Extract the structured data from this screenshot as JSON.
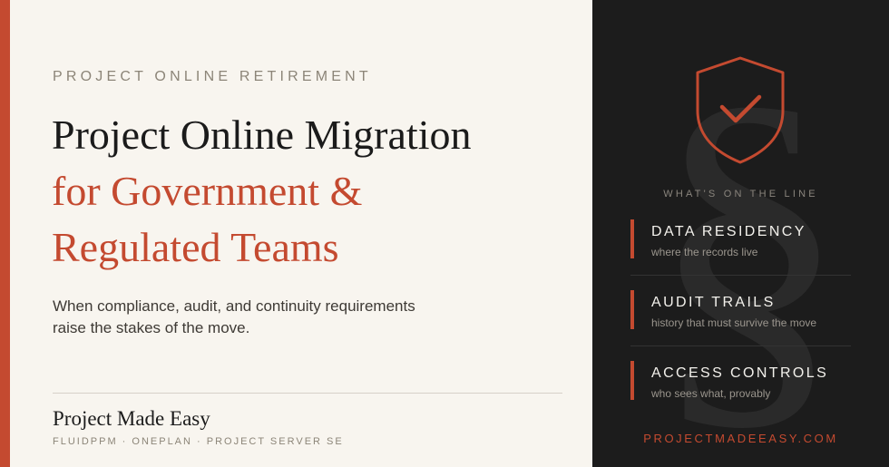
{
  "hero": {
    "eyebrow": "PROJECT ONLINE RETIREMENT",
    "title_line1": "Project Online Migration",
    "title_line2": "for Government &",
    "title_line3": "Regulated Teams",
    "lede": "When compliance, audit, and continuity requirements raise the stakes of the move."
  },
  "footer": {
    "brand": "Project Made Easy",
    "products": "FLUIDPPM · ONEPLAN · PROJECT SERVER SE"
  },
  "panel": {
    "background_glyph": "§",
    "heading": "WHAT'S ON THE LINE",
    "items": [
      {
        "label": "DATA RESIDENCY",
        "sub": "where the records live"
      },
      {
        "label": "AUDIT TRAILS",
        "sub": "history that must survive the move"
      },
      {
        "label": "ACCESS CONTROLS",
        "sub": "who sees what, provably"
      }
    ],
    "url": "PROJECTMADEEASY.COM"
  },
  "icons": {
    "shield": "shield-check-icon"
  },
  "colors": {
    "accent": "#c44a30",
    "dark_panel": "#1c1c1c",
    "paper": "#f8f5ef"
  }
}
